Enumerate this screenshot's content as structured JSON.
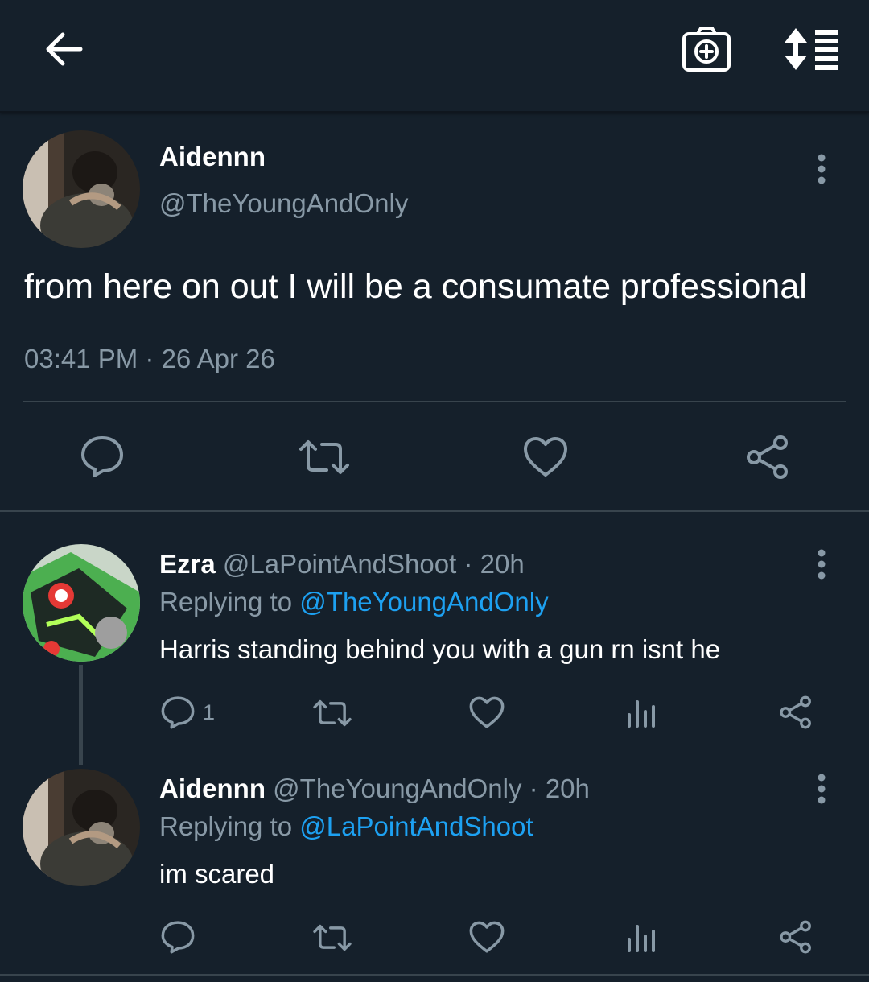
{
  "header": {
    "back_icon": "arrow-left-icon",
    "camera_icon": "camera-plus-icon",
    "sort_icon": "sort-list-icon"
  },
  "main_tweet": {
    "display_name": "Aidennn",
    "handle": "@TheYoungAndOnly",
    "text": "from here on out I will be a consumate professional",
    "timestamp": "03:41 PM · 26 Apr 26"
  },
  "replies": [
    {
      "display_name": "Ezra",
      "handle": "@LaPointAndShoot",
      "time": "· 20h",
      "replying_prefix": "Replying to",
      "replying_to": "@TheYoungAndOnly",
      "text": "Harris standing behind you with a gun rn isnt he",
      "reply_count": "1"
    },
    {
      "display_name": "Aidennn",
      "handle": "@TheYoungAndOnly",
      "time": "· 20h",
      "replying_prefix": "Replying to",
      "replying_to": "@LaPointAndShoot",
      "text": "im scared",
      "reply_count": ""
    }
  ],
  "colors": {
    "background": "#15202b",
    "muted": "#8899a6",
    "link": "#1da1f2",
    "divider": "#38444d"
  }
}
